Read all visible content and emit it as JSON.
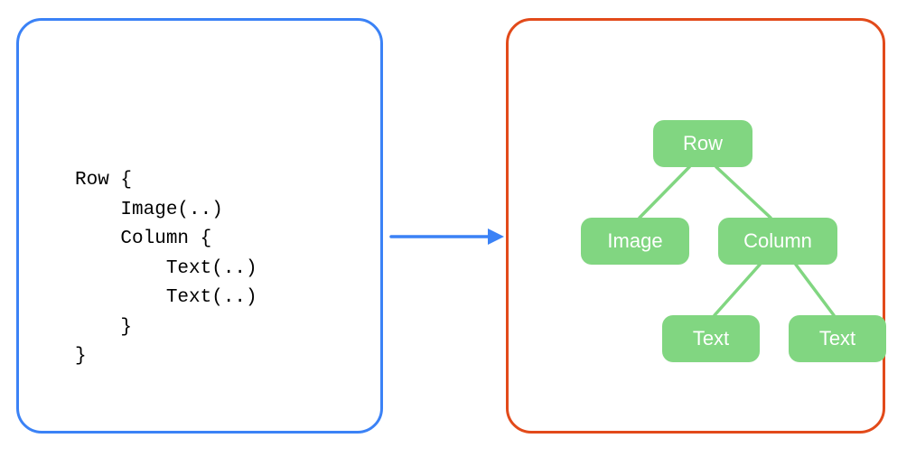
{
  "colors": {
    "left_panel_border": "#3b82f6",
    "right_panel_border": "#e24a1a",
    "arrow": "#3b82f6",
    "node_bg": "#81d681",
    "node_text": "#ffffff"
  },
  "left_panel": {
    "code_lines": [
      "Row {",
      "    Image(..)",
      "    Column {",
      "        Text(..)",
      "        Text(..)",
      "    }",
      "}"
    ]
  },
  "right_panel": {
    "tree": {
      "root": "Row",
      "children": [
        {
          "label": "Image"
        },
        {
          "label": "Column",
          "children": [
            {
              "label": "Text"
            },
            {
              "label": "Text"
            }
          ]
        }
      ]
    },
    "nodes": {
      "row": "Row",
      "image": "Image",
      "column": "Column",
      "text1": "Text",
      "text2": "Text"
    }
  }
}
